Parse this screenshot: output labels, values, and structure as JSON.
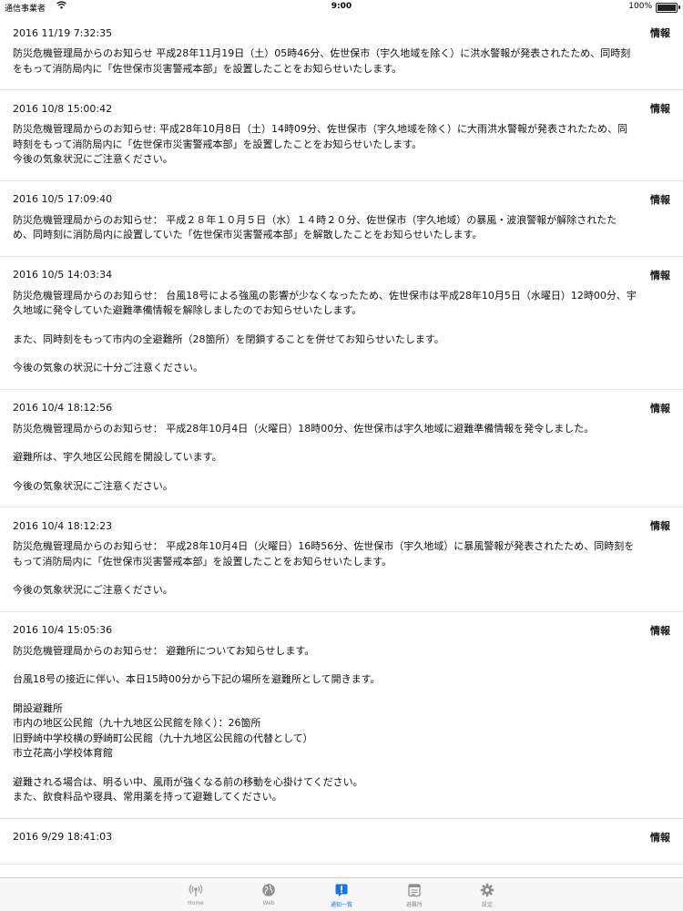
{
  "status_bar": {
    "carrier": "通信事業者",
    "time": "9:00",
    "battery": "100%"
  },
  "notices": [
    {
      "date": "2016 11/19 7:32:35",
      "category": "情報",
      "paragraphs": [
        "防災危機管理局からのお知らせ 平成28年11月19日（土）05時46分、佐世保市（宇久地域を除く）に洪水警報が発表されたため、同時刻\nをもって消防局内に「佐世保市災害警戒本部」を設置したことをお知らせいたします。"
      ]
    },
    {
      "date": "2016 10/8 15:00:42",
      "category": "情報",
      "paragraphs": [
        "防災危機管理局からのお知らせ: 平成28年10月8日（土）14時09分、佐世保市（宇久地域を除く）に大雨洪水警報が発表されたため、同\n時刻をもって消防局内に「佐世保市災害警戒本部」を設置したことをお知らせいたします。\n今後の気象状況にご注意ください。"
      ]
    },
    {
      "date": "2016 10/5 17:09:40",
      "category": "情報",
      "paragraphs": [
        "防災危機管理局からのお知らせ： 平成２８年１０月５日（水）１４時２０分、佐世保市（宇久地域）の暴風・波浪警報が解除されたた\nめ、同時刻に消防局内に設置していた「佐世保市災害警戒本部」を解散したことをお知らせいたします。"
      ]
    },
    {
      "date": "2016 10/5 14:03:34",
      "category": "情報",
      "paragraphs": [
        "防災危機管理局からのお知らせ： 台風18号による強風の影響が少なくなったため、佐世保市は平成28年10月5日（水曜日）12時00分、宇\n久地域に発令していた避難準備情報を解除しましたのでお知らせいたします。",
        "また、同時刻をもって市内の全避難所（28箇所）を閉鎖することを併せてお知らせいたします。",
        "今後の気象の状況に十分ご注意ください。"
      ]
    },
    {
      "date": "2016 10/4 18:12:56",
      "category": "情報",
      "paragraphs": [
        "防災危機管理局からのお知らせ： 平成28年10月4日（火曜日）18時00分、佐世保市は宇久地域に避難準備情報を発令しました。",
        "避難所は、宇久地区公民館を開設しています。",
        "今後の気象状況にご注意ください。"
      ]
    },
    {
      "date": "2016 10/4 18:12:23",
      "category": "情報",
      "paragraphs": [
        "防災危機管理局からのお知らせ： 平成28年10月4日（火曜日）16時56分、佐世保市（宇久地域）に暴風警報が発表されたため、同時刻を\nもって消防局内に「佐世保市災害警戒本部」を設置したことをお知らせいたします。",
        "今後の気象状況にご注意ください。"
      ]
    },
    {
      "date": "2016 10/4 15:05:36",
      "category": "情報",
      "paragraphs": [
        "防災危機管理局からのお知らせ： 避難所についてお知らせします。",
        "台風18号の接近に伴い、本日15時00分から下記の場所を避難所として開きます。",
        "開設避難所\n市内の地区公民館（九十九地区公民館を除く）：26箇所\n旧野崎中学校横の野崎町公民館（九十九地区公民館の代替として）\n市立花高小学校体育館",
        "避難される場合は、明るい中、風雨が強くなる前の移動を心掛けてください。\nまた、飲食料品や寝具、常用薬を持って避難してください。"
      ]
    },
    {
      "date": "2016 9/29 18:41:03",
      "category": "情報",
      "paragraphs": []
    }
  ],
  "tab_bar": {
    "tabs": [
      {
        "label": "Home",
        "icon": "broadcast-icon"
      },
      {
        "label": "Web",
        "icon": "globe-icon"
      },
      {
        "label": "通知一覧",
        "icon": "alert-icon"
      },
      {
        "label": "避難所",
        "icon": "list-icon"
      },
      {
        "label": "設定",
        "icon": "gear-icon"
      }
    ],
    "active_index": 2,
    "active_color": "#1a73e8",
    "inactive_color": "#8e8e93"
  }
}
